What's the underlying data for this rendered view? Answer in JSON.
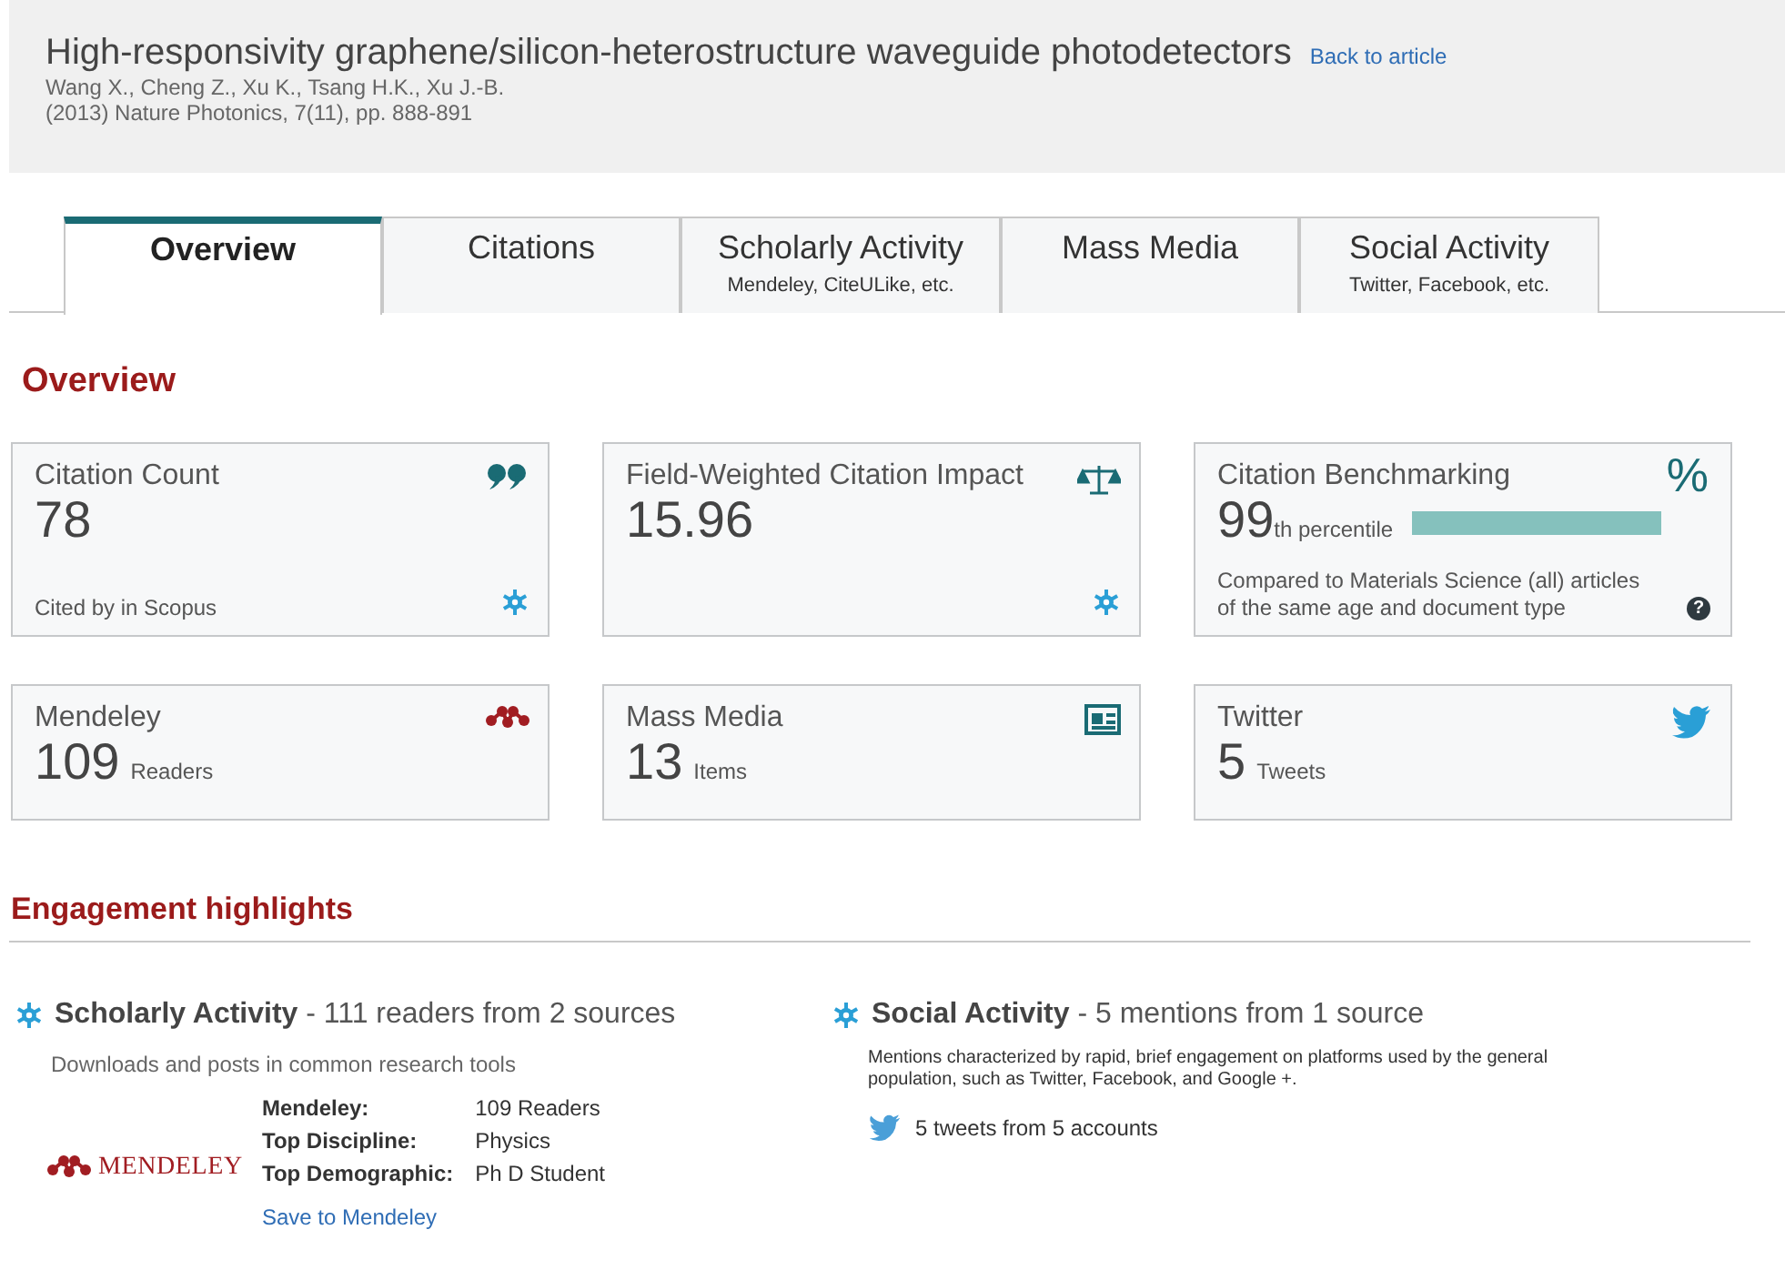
{
  "header": {
    "title": "High-responsivity graphene/silicon-heterostructure waveguide photodetectors",
    "back_link": "Back to article",
    "authors": "Wang X., Cheng Z., Xu K., Tsang H.K., Xu J.-B.",
    "source": "(2013) Nature Photonics, 7(11), pp. 888-891"
  },
  "tabs": [
    {
      "label": "Overview",
      "selected": true
    },
    {
      "label": "Citations",
      "selected": false
    },
    {
      "label": "Scholarly Activity",
      "sublabel": "Mendeley, CiteULike, etc.",
      "selected": false
    },
    {
      "label": "Mass Media",
      "selected": false
    },
    {
      "label": "Social Activity",
      "sublabel": "Twitter, Facebook, etc.",
      "selected": false
    }
  ],
  "section_title": "Overview",
  "metrics": [
    {
      "kind": "count",
      "title": "Citation Count",
      "value": "78",
      "note": "Cited by in Scopus"
    },
    {
      "kind": "count",
      "title": "Field-Weighted Citation Impact",
      "value": "15.96"
    },
    {
      "kind": "benchmark",
      "title": "Citation Benchmarking",
      "icon_text": "%",
      "value": "99",
      "suffix": "th percentile",
      "note": "Compared to Materials Science (all) articles of the same age and document type",
      "help": "?"
    },
    {
      "kind": "unit",
      "title": "Mendeley",
      "value": "109",
      "unit": "Readers"
    },
    {
      "kind": "unit",
      "title": "Mass Media",
      "value": "13",
      "unit": "Items"
    },
    {
      "kind": "unit",
      "title": "Twitter",
      "value": "5",
      "unit": "Tweets"
    }
  ],
  "engagement": {
    "title": "Engagement highlights",
    "scholarly": {
      "heading": "**Scholarly Activity** - 111 readers from 2 sources",
      "description": "Downloads and posts in common research tools",
      "logo": "MENDELEY",
      "details": [
        {
          "label": "Mendeley:",
          "value": "109 Readers"
        },
        {
          "label": "Top Discipline:",
          "value": "Physics"
        },
        {
          "label": "Top Demographic:",
          "value": "Ph D Student"
        }
      ],
      "link": "Save to Mendeley"
    },
    "social": {
      "heading": "**Social Activity** - 5 mentions from 1 source",
      "description": "Mentions characterized by rapid, brief engagement on platforms used by the general population, such as Twitter, Facebook, and Google +.",
      "tweets": "5 tweets from 5 accounts"
    }
  }
}
